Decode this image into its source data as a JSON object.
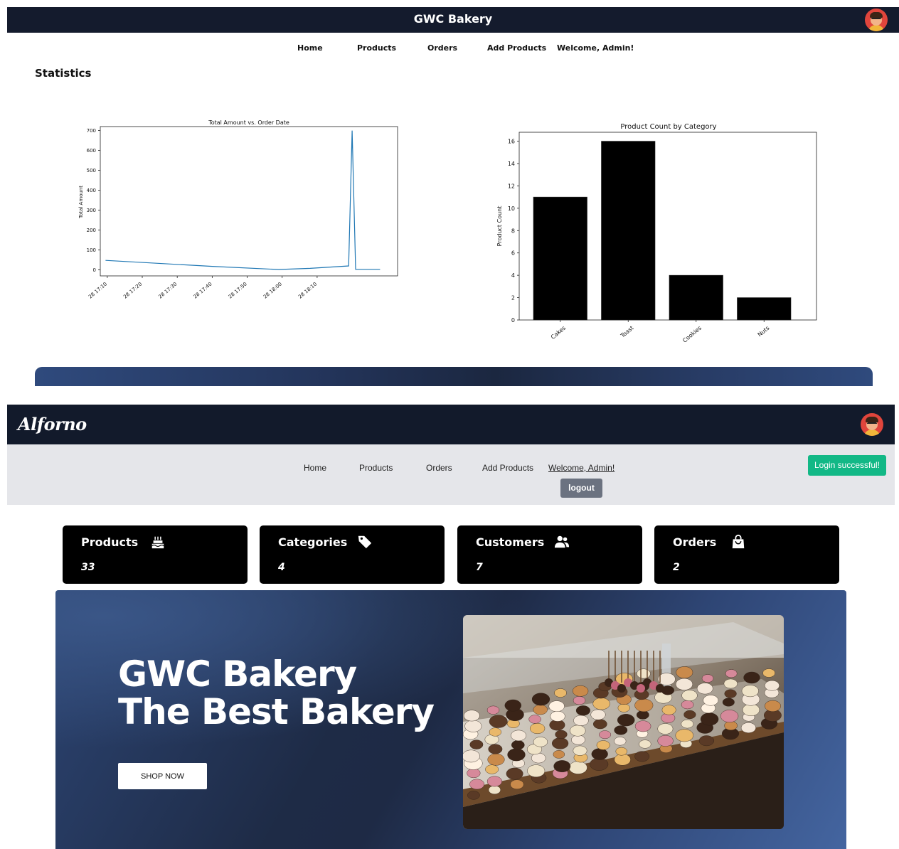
{
  "top": {
    "app_title": "GWC Bakery",
    "nav": [
      "Home",
      "Products",
      "Orders",
      "Add Products",
      "Welcome, Admin!"
    ],
    "heading": "Statistics"
  },
  "chart_data": [
    {
      "type": "line",
      "title": "Total Amount vs. Order Date",
      "xlabel": "",
      "ylabel": "Total Amount",
      "x_ticks": [
        "28 17:10",
        "28 17:20",
        "28 17:30",
        "28 17:40",
        "28 17:50",
        "28 18:00",
        "28 18:10"
      ],
      "y_ticks": [
        0,
        100,
        200,
        300,
        400,
        500,
        600,
        700
      ],
      "ylim": [
        -30,
        720
      ],
      "xlim": [
        "28 17:08",
        "28 18:23"
      ],
      "x_minutes": [
        9.5,
        40,
        59,
        68,
        79,
        80,
        81,
        87,
        88
      ],
      "x": [
        "28 17:10",
        "28 17:40",
        "28 17:59",
        "28 18:08",
        "28 18:19",
        "28 18:20",
        "28 18:21",
        "28 18:27",
        "28 18:28"
      ],
      "series": [
        {
          "values": [
            48,
            18,
            2,
            8,
            20,
            700,
            3,
            3,
            3
          ],
          "color": "#1f77b4"
        }
      ],
      "grid": false
    },
    {
      "type": "bar",
      "title": "Product Count by Category",
      "xlabel": "",
      "ylabel": "Product Count",
      "categories": [
        "Cakes",
        "Toast",
        "Cookies",
        "Nuts"
      ],
      "values": [
        11,
        16,
        4,
        2
      ],
      "y_ticks": [
        0,
        2,
        4,
        6,
        8,
        10,
        12,
        14,
        16
      ],
      "ylim": [
        0,
        16.8
      ],
      "bar_color": "#000000",
      "grid": false
    }
  ],
  "bottom": {
    "logo": "Alforno",
    "nav": [
      "Home",
      "Products",
      "Orders",
      "Add Products",
      "Welcome, Admin!"
    ],
    "logout": "logout",
    "toast": "Login successful!",
    "cards": [
      {
        "label": "Products",
        "value": "33",
        "icon": "cake-icon"
      },
      {
        "label": "Categories",
        "value": "4",
        "icon": "tag-icon"
      },
      {
        "label": "Customers",
        "value": "7",
        "icon": "users-icon"
      },
      {
        "label": "Orders",
        "value": "2",
        "icon": "shopping-bag-icon"
      }
    ],
    "hero": {
      "line1": "GWC Bakery",
      "line2": "The Best Bakery",
      "button": "SHOP NOW"
    }
  },
  "colors": {
    "header_bg": "#141b2d",
    "subnav_bg": "#e5e6ea",
    "toast_bg": "#12b886",
    "logout_bg": "#6b7280",
    "card_bg": "#000000",
    "hero_accent": "#2c4472"
  }
}
